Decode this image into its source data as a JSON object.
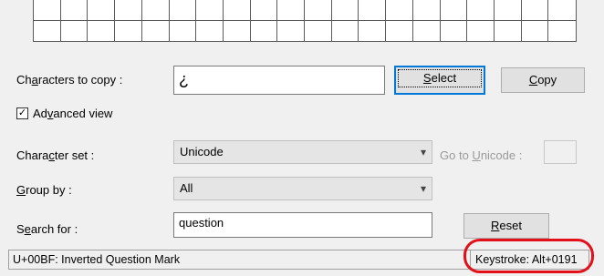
{
  "characters_to_copy": {
    "label_pre": "Ch",
    "label_u": "a",
    "label_post": "racters to copy :",
    "value": "¿"
  },
  "buttons": {
    "select": {
      "pre": "",
      "u": "S",
      "post": "elect"
    },
    "copy": {
      "pre": "",
      "u": "C",
      "post": "opy"
    },
    "reset": {
      "pre": "",
      "u": "R",
      "post": "eset"
    }
  },
  "advanced_view": {
    "pre": "Ad",
    "u": "v",
    "post": "anced view",
    "checked": true,
    "check_mark": "✓"
  },
  "character_set": {
    "label_pre": "Chara",
    "label_u": "c",
    "label_post": "ter set :",
    "value": "Unicode"
  },
  "go_to_unicode": {
    "pre": "Go to ",
    "u": "U",
    "post": "nicode :",
    "value": ""
  },
  "group_by": {
    "label_pre": "",
    "label_u": "G",
    "label_post": "roup by :",
    "value": "All"
  },
  "search_for": {
    "label_pre": "S",
    "label_u": "e",
    "label_post": "arch for :",
    "value": "question"
  },
  "status": {
    "character_info": "U+00BF: Inverted Question Mark",
    "keystroke": "Keystroke: Alt+0191"
  },
  "icons": {
    "dropdown": "▾"
  },
  "colors": {
    "highlight": "#e3101a",
    "accent": "#0078d7"
  }
}
